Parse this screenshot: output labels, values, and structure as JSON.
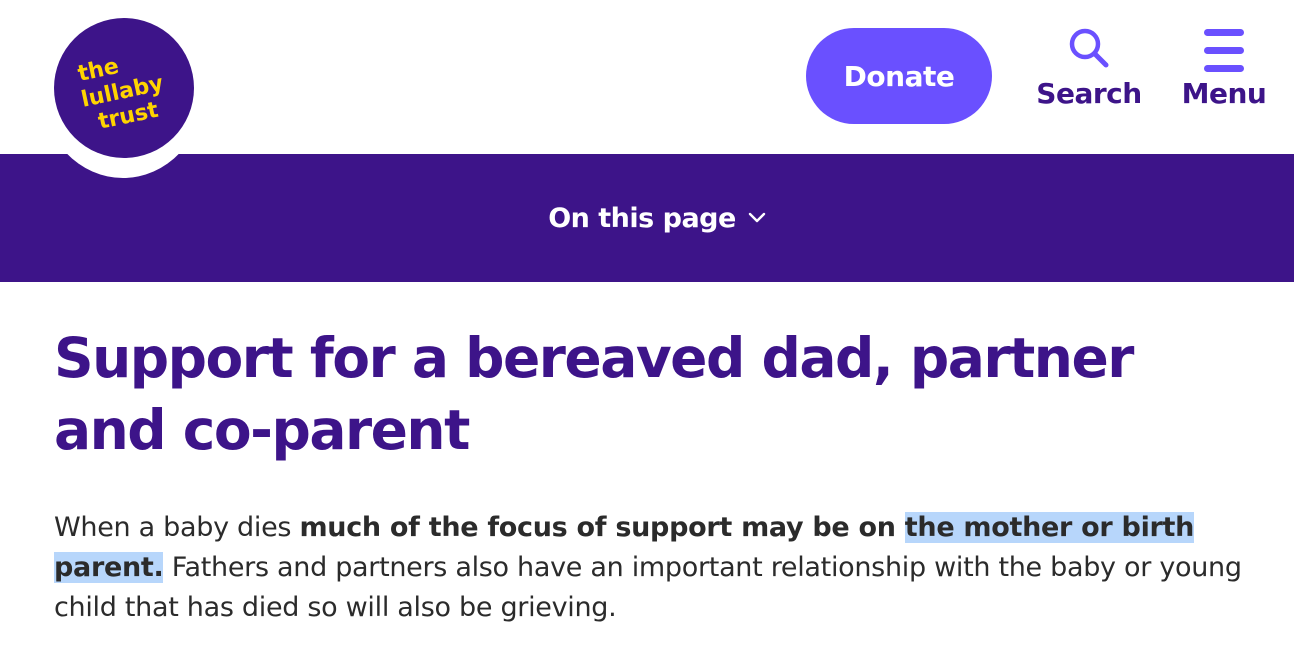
{
  "header": {
    "logo": {
      "line1": "the",
      "line2": "lullaby",
      "line3": "trust",
      "icon": "lullaby-trust-logo"
    },
    "donate_label": "Donate",
    "search": {
      "label": "Search",
      "icon": "search-icon"
    },
    "menu": {
      "label": "Menu",
      "icon": "hamburger-menu-icon"
    }
  },
  "on_this_page": {
    "label": "On this page",
    "icon": "chevron-down-icon"
  },
  "main": {
    "title": "Support for a bereaved dad, partner and co-parent",
    "intro": {
      "part1": "When a baby dies ",
      "bold": "much of the focus of support may be on ",
      "highlighted": "the mother or birth parent.",
      "part2": " Fathers and partners also have an important relationship with the baby or young child that has died so will also be grieving."
    }
  },
  "colors": {
    "brand_purple": "#3d1489",
    "accent_violet": "#6a50ff",
    "logo_yellow": "#ffd400",
    "selection_highlight": "#b7d6fb",
    "body_text": "#2b2b2b"
  }
}
